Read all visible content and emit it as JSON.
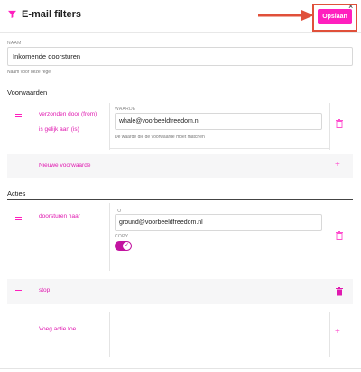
{
  "header": {
    "title": "E-mail filters",
    "save_label": "Opslaan",
    "close_glyph": "×",
    "filter_icon": "filter-icon",
    "accent_color": "#ff1fbe",
    "annotation_color": "#e0503a"
  },
  "name_field": {
    "label": "NAAM",
    "value": "Inkomende doorsturen",
    "help": "Naam voor deze regel"
  },
  "conditions": {
    "title": "Voorwaarden",
    "items": [
      {
        "field": "verzonden door (from)",
        "operator": "is gelijk aan (is)",
        "value_label": "WAARDE",
        "value": "whale@voorbeeldfreedom.nl",
        "value_help": "De waarde die de voorwaarde moet matchen"
      }
    ],
    "add_label": "Nieuwe voorwaarde"
  },
  "actions": {
    "title": "Acties",
    "items": [
      {
        "type": "doorsturen naar",
        "to_label": "TO",
        "to_value": "ground@voorbeeldfreedom.nl",
        "copy_label": "COPY",
        "copy_enabled": true
      },
      {
        "type": "stop"
      }
    ],
    "add_label": "Voeg actie toe"
  }
}
